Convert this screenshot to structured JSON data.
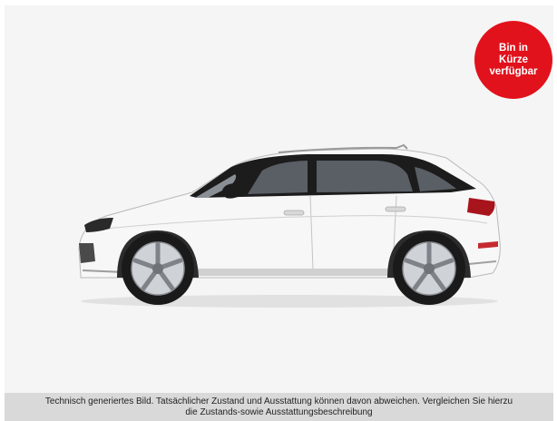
{
  "badge": {
    "line1": "Bin in",
    "line2": "Kürze",
    "line3": "verfügbar",
    "color": "#e1121c"
  },
  "image": {
    "icon": "car-side-image",
    "body_color": "#f7f7f7"
  },
  "disclaimer": {
    "line1": "Technisch generiertes Bild. Tatsächlicher Zustand und Ausstattung können davon abweichen. Vergleichen Sie hierzu",
    "line2": "die Zustands-sowie Ausstattungsbeschreibung"
  }
}
